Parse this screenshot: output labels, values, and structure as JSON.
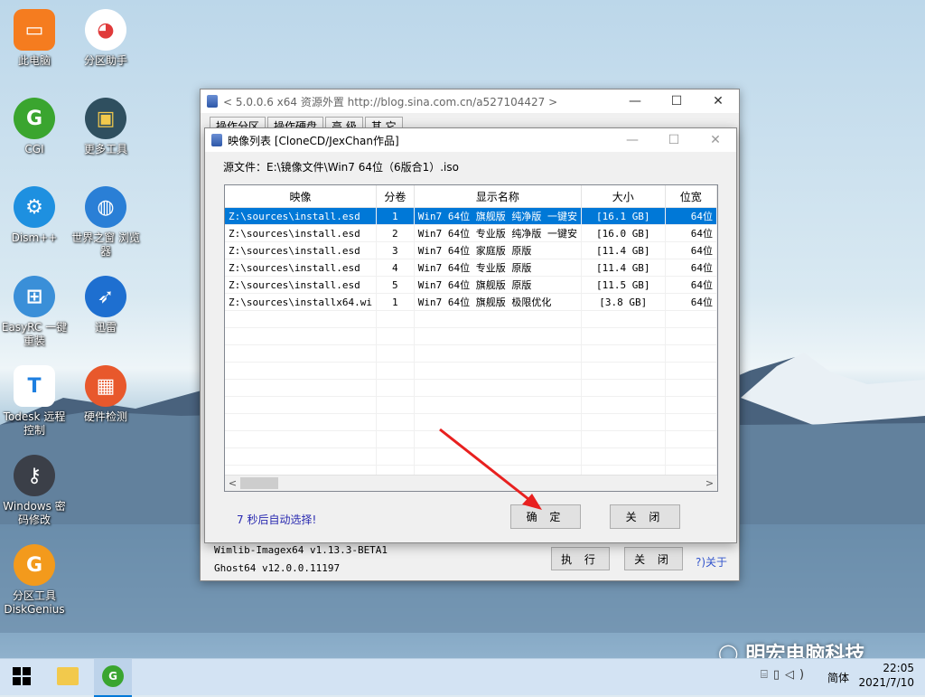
{
  "desktop": {
    "icons": [
      {
        "label": "此电脑",
        "icon": "computer-icon",
        "color": "#f57c1f"
      },
      {
        "label": "分区助手",
        "icon": "partition-assistant-icon",
        "color": "#ffffff"
      },
      {
        "label": "CGI",
        "icon": "cgi-icon",
        "color": "#3aa52f"
      },
      {
        "label": "更多工具",
        "icon": "toolbox-icon",
        "color": "#2f4f5f"
      },
      {
        "label": "Dism++",
        "icon": "dism-gear-icon",
        "color": "#1e90e0"
      },
      {
        "label": "世界之窗 浏览器",
        "icon": "browser-globe-icon",
        "color": "#2a7fd6"
      },
      {
        "label": "EasyRC 一键重装",
        "icon": "windows-logo-icon",
        "color": "#3a8fd8"
      },
      {
        "label": "迅雷",
        "icon": "thunder-bird-icon",
        "color": "#1e6fd0"
      },
      {
        "label": "Todesk 远程控制",
        "icon": "todesk-icon",
        "color": "#ffffff"
      },
      {
        "label": "硬件检测",
        "icon": "cpu-chip-icon",
        "color": "#e8582c"
      },
      {
        "label": "Windows 密码修改",
        "icon": "key-icon",
        "color": "#3b3f48"
      },
      {
        "label": "分区工具 DiskGenius",
        "icon": "diskgenius-icon",
        "color": "#f39a1c"
      }
    ]
  },
  "main_window": {
    "title": "< 5.0.0.6 x64 资源外置 http://blog.sina.com.cn/a527104427 >",
    "tabs": [
      "操作分区",
      "操作硬盘",
      "高 级",
      "其 它"
    ],
    "version_lines": [
      "Wimlib-Imagex64 v1.13.3-BETA1",
      "Ghost64 v12.0.0.11197"
    ],
    "execute_label": "执 行",
    "close_label": "关 闭",
    "about_label": "?)关于"
  },
  "dialog": {
    "title": "映像列表 [CloneCD/JexChan作品]",
    "source_label": "源文件：E:\\镜像文件\\Win7 64位（6版合1）.iso",
    "columns": [
      "映像",
      "分卷",
      "显示名称",
      "大小",
      "位宽"
    ],
    "rows": [
      [
        "Z:\\sources\\install.esd",
        "1",
        "Win7 64位 旗舰版 纯净版 一键安",
        "[16.1 GB]",
        "64位"
      ],
      [
        "Z:\\sources\\install.esd",
        "2",
        "Win7 64位 专业版 纯净版 一键安",
        "[16.0 GB]",
        "64位"
      ],
      [
        "Z:\\sources\\install.esd",
        "3",
        "Win7 64位 家庭版 原版",
        "[11.4 GB]",
        "64位"
      ],
      [
        "Z:\\sources\\install.esd",
        "4",
        "Win7 64位 专业版 原版",
        "[11.4 GB]",
        "64位"
      ],
      [
        "Z:\\sources\\install.esd",
        "5",
        "Win7 64位 旗舰版 原版",
        "[11.5 GB]",
        "64位"
      ],
      [
        "Z:\\sources\\installx64.wi",
        "1",
        "Win7 64位 旗舰版 极限优化",
        "[3.8 GB]",
        "64位"
      ]
    ],
    "selected_row": 0,
    "auto_select_text": "7 秒后自动选择!",
    "ok_label": "确 定",
    "close_label": "关 闭"
  },
  "taskbar": {
    "time": "22:05",
    "date": "2021/7/10",
    "ime": "简体"
  },
  "watermark": "明宏电脑科技",
  "colors": {
    "selection": "#0078d7",
    "arrow": "#e8201f",
    "taskbar": "#d3e3f3"
  }
}
